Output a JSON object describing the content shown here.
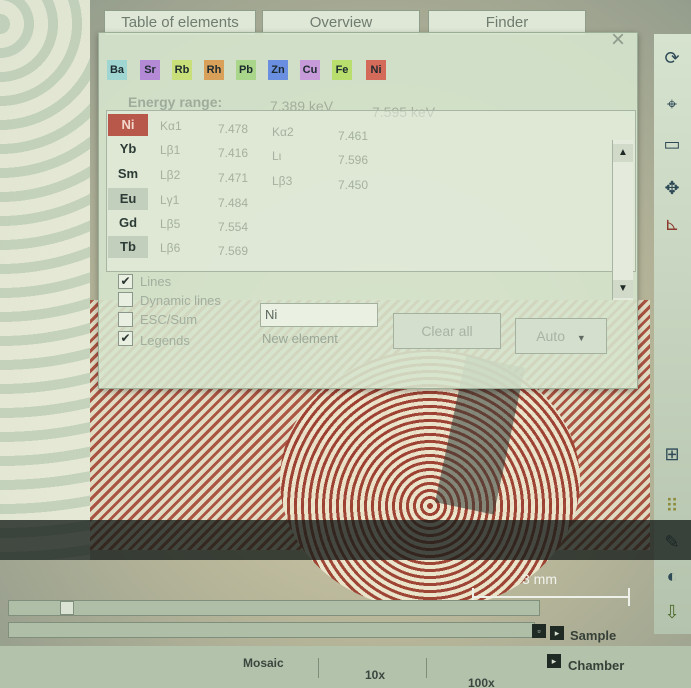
{
  "tabs": [
    {
      "label": "Table of elements"
    },
    {
      "label": "Overview"
    },
    {
      "label": "Finder"
    }
  ],
  "elements_bar": [
    {
      "symbol": "Ba",
      "color": "#9fd6d2"
    },
    {
      "symbol": "Sr",
      "color": "#b48ad6"
    },
    {
      "symbol": "Rb",
      "color": "#c9e07a"
    },
    {
      "symbol": "Rh",
      "color": "#d9a05a"
    },
    {
      "symbol": "Pb",
      "color": "#a9d68a"
    },
    {
      "symbol": "Zn",
      "color": "#6a8fe0"
    },
    {
      "symbol": "Cu",
      "color": "#c79ad9"
    },
    {
      "symbol": "Fe",
      "color": "#b9de6e"
    },
    {
      "symbol": "Ni",
      "color": "#d46a5a"
    }
  ],
  "energy_range": {
    "label": "Energy range:",
    "low": "7.389 keV",
    "high": "7.595 keV"
  },
  "lines": [
    {
      "symbol": "Ni",
      "c1": "Kα1",
      "c2": "7.478",
      "c3": "Kα2",
      "c4": "7.461"
    },
    {
      "symbol": "Yb",
      "c1": "Lβ1",
      "c2": "7.416",
      "c3": "Lι",
      "c4": "7.596"
    },
    {
      "symbol": "Sm",
      "c1": "Lβ2",
      "c2": "7.471",
      "c3": "Lβ3",
      "c4": "7.450"
    },
    {
      "symbol": "Eu",
      "c1": "Lγ1",
      "c2": "7.484",
      "c3": "",
      "c4": ""
    },
    {
      "symbol": "Gd",
      "c1": "Lβ5",
      "c2": "7.554",
      "c3": "",
      "c4": ""
    },
    {
      "symbol": "Tb",
      "c1": "Lβ6",
      "c2": "7.569",
      "c3": "",
      "c4": ""
    }
  ],
  "options": {
    "lines": {
      "label": "Lines",
      "checked": true
    },
    "dynamic_lines": {
      "label": "Dynamic lines",
      "checked": false
    },
    "esc_sum": {
      "label": "ESC/Sum",
      "checked": false
    },
    "legends": {
      "label": "Legends",
      "checked": true
    }
  },
  "new_element": {
    "value": "Ni",
    "caption": "New element"
  },
  "buttons": {
    "clear_all": "Clear all",
    "auto": "Auto"
  },
  "scale": {
    "label": "3 mm"
  },
  "bottom": {
    "sample_label": "Sample",
    "chamber_label": "Chamber",
    "modes": [
      "Mosaic",
      "10x",
      "100x"
    ]
  },
  "toolbar_icons": [
    "refresh-icon",
    "crosshair-box-icon",
    "region-box-icon",
    "move-arrows-icon",
    "ruler-icon",
    "grid-icon",
    "dotted-grid-icon",
    "pen-icon",
    "brightness-icon",
    "export-icon"
  ]
}
